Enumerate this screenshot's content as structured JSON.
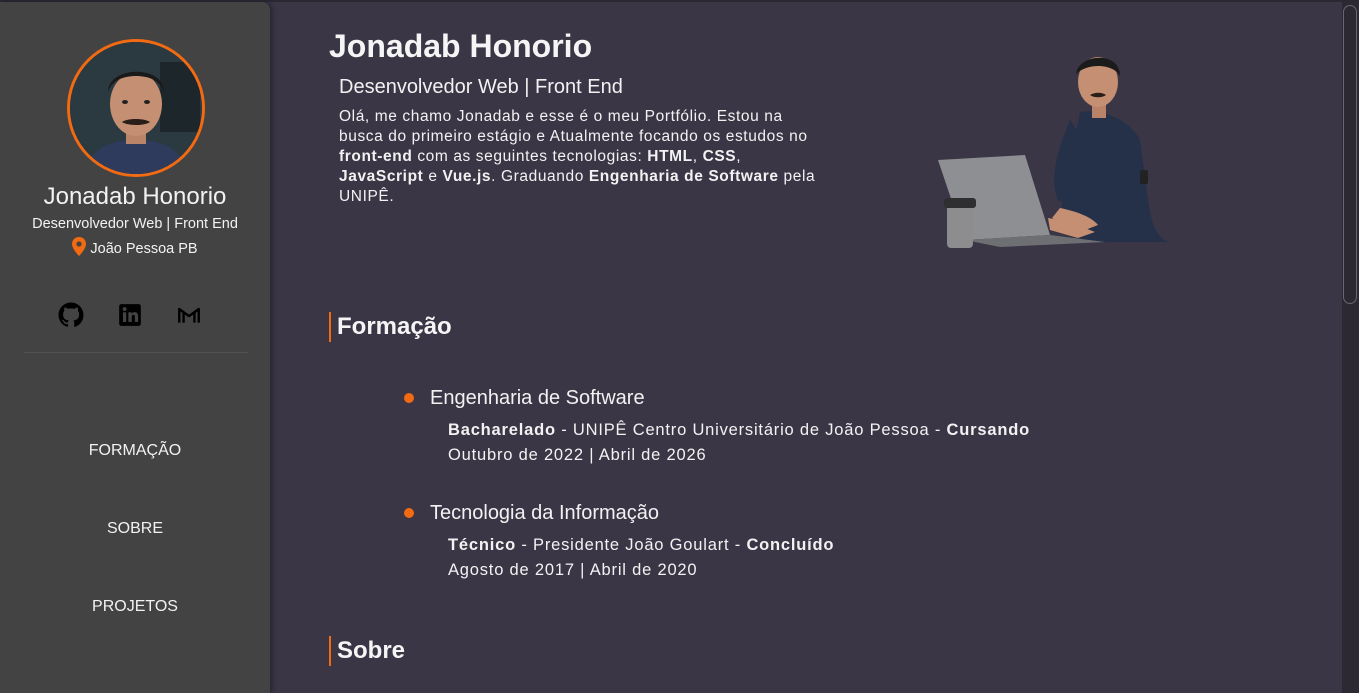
{
  "sidebar": {
    "name": "Jonadab Honorio",
    "role": "Desenvolvedor Web | Front End",
    "location": "João Pessoa PB",
    "socials": [
      "github-icon",
      "linkedin-icon",
      "gmail-icon"
    ],
    "nav": [
      {
        "label": "FORMAÇÃO"
      },
      {
        "label": "SOBRE"
      },
      {
        "label": "PROJETOS"
      }
    ]
  },
  "header": {
    "name": "Jonadab Honorio",
    "role": "Desenvolvedor Web | Front End",
    "intro": {
      "p1": "Olá, me chamo Jonadab e esse é o meu Portfólio. Estou na busca do primeiro estágio e Atualmente focando os estudos no ",
      "b1": "front-end",
      "p2": " com as seguintes tecnologias: ",
      "b2": "HTML",
      "p3": ", ",
      "b3": "CSS",
      "p4": ", ",
      "b4": "JavaScript",
      "p5": " e ",
      "b5": "Vue.js",
      "p6": ". Graduando ",
      "b6": "Engenharia de Software",
      "p7": " pela UNIPÊ."
    }
  },
  "formacao": {
    "title": "Formação",
    "items": [
      {
        "course": "Engenharia de Software",
        "degree": "Bacharelado",
        "sep1": " - ",
        "institution": "UNIPÊ Centro Universitário de João Pessoa",
        "sep2": " - ",
        "status": "Cursando",
        "period": "Outubro de 2022 | Abril de 2026"
      },
      {
        "course": "Tecnologia da Informação",
        "degree": "Técnico",
        "sep1": " - ",
        "institution": "Presidente João Goulart",
        "sep2": " - ",
        "status": "Concluído",
        "period": "Agosto de 2017 | Abril de 2020"
      }
    ]
  },
  "sobre": {
    "title": "Sobre"
  },
  "colors": {
    "accent": "#f26a11",
    "background": "#3a3646",
    "sidebar": "#444344"
  }
}
